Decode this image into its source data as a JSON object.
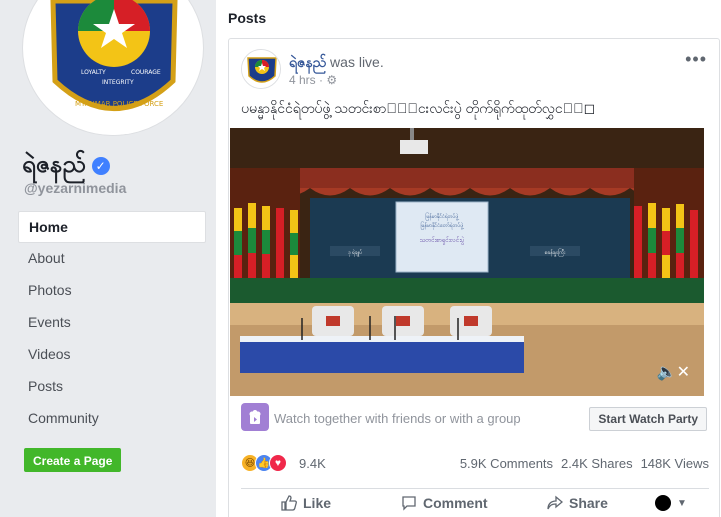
{
  "page": {
    "name": "ရဲဇနည်",
    "handle": "@yezarnimedia",
    "profile_ring_text_left": "LOYALTY",
    "profile_ring_text_mid": "INTEGRITY",
    "profile_ring_text_right": "COURAGE",
    "profile_ring_text_bottom": "MYANMAR POLICE FORCE"
  },
  "nav": {
    "items": [
      {
        "label": "Home",
        "active": true
      },
      {
        "label": "About"
      },
      {
        "label": "Photos"
      },
      {
        "label": "Events"
      },
      {
        "label": "Videos"
      },
      {
        "label": "Posts"
      },
      {
        "label": "Community"
      }
    ],
    "create_page": "Create a Page"
  },
  "main": {
    "section_title": "Posts"
  },
  "post": {
    "author": "ရဲဇနည်",
    "action": "was live.",
    "time": "4 hrs ·",
    "text": "ပမန္မာနိုင်ငံရဲတပ်ဖွဲ့ သတင်းစာ◻ျ်ငးလင်းပွဲ တိုက်ရိုက်ထုတ်လွှင◻ျ◻",
    "more": "•••",
    "video": {
      "screen_lines": [
        "မြန်မာနိုင်ငံရဲတပ်ဖွဲ့",
        "မြန်မာနိုင်ငံတော်ရဲတပ်ဖွဲ့",
        "သတင်းစာရှင်းလင်းပွဲ"
      ],
      "banner_left": "ဒု ရဲချုပ်",
      "banner_right": "စခန်းမှူးကြီး"
    },
    "watch_party": {
      "text": "Watch together with friends or with a group",
      "button": "Start Watch Party"
    },
    "stats": {
      "reactions_count": "9.4K",
      "comments": "5.9K Comments",
      "shares": "2.4K Shares",
      "views": "148K Views"
    },
    "actions": {
      "like": "Like",
      "comment": "Comment",
      "share": "Share"
    }
  },
  "colors": {
    "brand": "#365899",
    "green_button": "#42b72a",
    "verified": "#4080ff"
  }
}
